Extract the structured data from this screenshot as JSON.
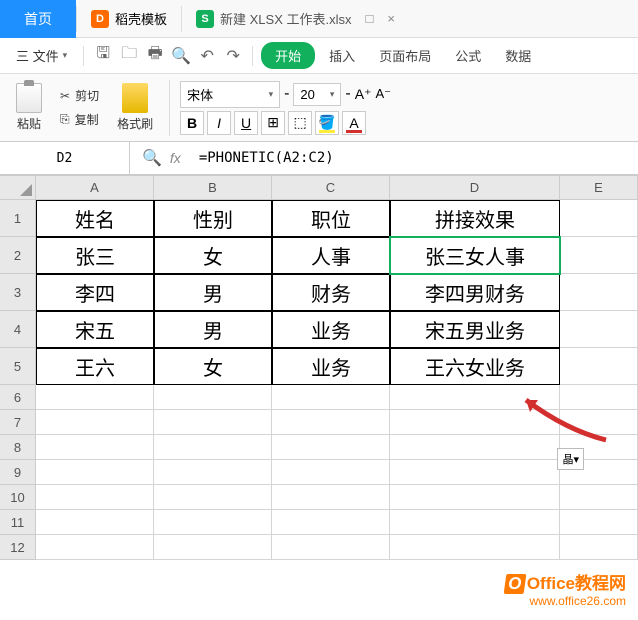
{
  "tabs": {
    "home": "首页",
    "docer": "稻壳模板",
    "file_name": "新建 XLSX 工作表.xlsx"
  },
  "menu": {
    "file": "三 文件",
    "start": "开始",
    "insert": "插入",
    "layout": "页面布局",
    "formula": "公式",
    "data": "数据"
  },
  "toolbar": {
    "paste": "粘贴",
    "cut": "剪切",
    "copy": "复制",
    "format_painter": "格式刷",
    "font_name": "宋体",
    "font_size": "20"
  },
  "formula_bar": {
    "cell_ref": "D2",
    "formula": "=PHONETIC(A2:C2)"
  },
  "columns": [
    "A",
    "B",
    "C",
    "D",
    "E"
  ],
  "rows": [
    {
      "num": "1",
      "cells": [
        "姓名",
        "性别",
        "职位",
        "拼接效果"
      ]
    },
    {
      "num": "2",
      "cells": [
        "张三",
        "女",
        "人事",
        "张三女人事"
      ]
    },
    {
      "num": "3",
      "cells": [
        "李四",
        "男",
        "财务",
        "李四男财务"
      ]
    },
    {
      "num": "4",
      "cells": [
        "宋五",
        "男",
        "业务",
        "宋五男业务"
      ]
    },
    {
      "num": "5",
      "cells": [
        "王六",
        "女",
        "业务",
        "王六女业务"
      ]
    }
  ],
  "empty_rows": [
    "6",
    "7",
    "8",
    "9",
    "10",
    "11",
    "12"
  ],
  "watermark": {
    "title": "Office教程网",
    "url": "www.office26.com"
  },
  "floating_hint": "晶▾"
}
